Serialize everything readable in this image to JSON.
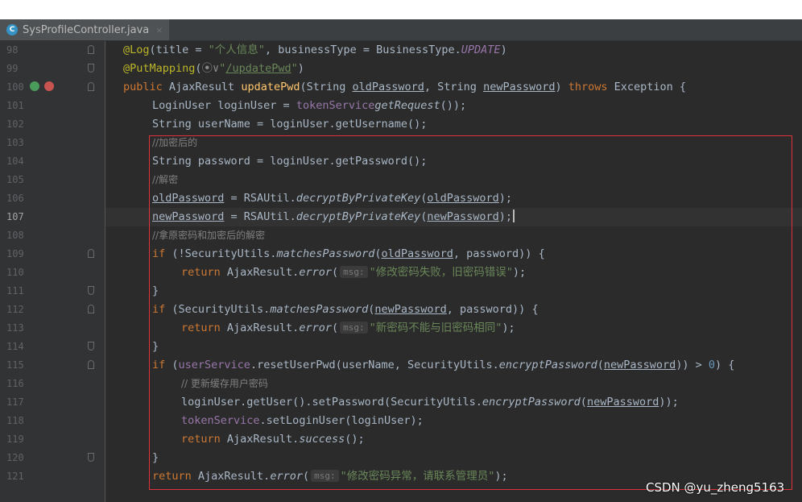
{
  "editor": {
    "tab_label": "SysProfileController.java",
    "tab_icon": "C",
    "close_glyph": "×",
    "current_line": "107"
  },
  "line_numbers": [
    "98",
    "99",
    "100",
    "101",
    "102",
    "103",
    "104",
    "105",
    "106",
    "107",
    "108",
    "109",
    "110",
    "111",
    "112",
    "113",
    "114",
    "115",
    "116",
    "117",
    "118",
    "119",
    "120",
    "121"
  ],
  "code": {
    "l98": {
      "ann": "@Log",
      "a": "(title = ",
      "s1": "\"个人信息\"",
      "b": ", businessType = BusinessType.",
      "c": "UPDATE",
      ")": ")"
    },
    "l99": {
      "ann": "@PutMapping",
      "a": "(",
      "icon": "⦿∨",
      "s1": "\"",
      "s2": "/updatePwd",
      "s3": "\"",
      ")": ")"
    },
    "l100": {
      "kw1": "public ",
      "a": "AjaxResult ",
      "fn": "updatePwd",
      "b": "(String ",
      "p1": "oldPassword",
      "c": ", String ",
      "p2": "newPassword",
      "d": ") ",
      "kw2": "throws ",
      "e": "Exception {"
    },
    "l101": {
      "a": "LoginUser loginUser = ",
      "f": "tokenService",
      ".": ".getLoginUser(ServletUtils.",
      "st": "getRequest",
      "b": "());"
    },
    "l102": {
      "a": "String userName = loginUser.getUsername();"
    },
    "l103": {
      "cm": "//加密后的"
    },
    "l104": {
      "a": "String password = loginUser.getPassword();"
    },
    "l105": {
      "cm": "//解密"
    },
    "l106": {
      "p": "oldPassword",
      "a": " = RSAUtil.",
      "st": "decryptByPrivateKey",
      "b": "(",
      "p2": "oldPassword",
      "c": ");"
    },
    "l107": {
      "p": "newPassword",
      "a": " = RSAUtil.",
      "st": "decryptByPrivateKey",
      "b": "(",
      "p2": "newPassword",
      "c": ");"
    },
    "l108": {
      "cm": "//拿原密码和加密后的解密"
    },
    "l109": {
      "kw": "if ",
      "a": "(!SecurityUtils.",
      "st": "matchesPassword",
      "b": "(",
      "p": "oldPassword",
      "c": ", password)) {"
    },
    "l110": {
      "kw": "return ",
      "a": "AjaxResult.",
      "st": "error",
      "b": "(",
      "hint": "msg:",
      "s": "\"修改密码失败，旧密码错误\"",
      "c": ");"
    },
    "l111": {
      "a": "}"
    },
    "l112": {
      "kw": "if ",
      "a": "(SecurityUtils.",
      "st": "matchesPassword",
      "b": "(",
      "p": "newPassword",
      "c": ", password)) {"
    },
    "l113": {
      "kw": "return ",
      "a": "AjaxResult.",
      "st": "error",
      "b": "(",
      "hint": "msg:",
      "s": "\"新密码不能与旧密码相同\"",
      "c": ");"
    },
    "l114": {
      "a": "}"
    },
    "l115": {
      "kw": "if ",
      "a": "(",
      "f": "userService",
      "b": ".resetUserPwd(userName, SecurityUtils.",
      "st": "encryptPassword",
      "c": "(",
      "p": "newPassword",
      "d": ")) > ",
      "n": "0",
      "e": ") {"
    },
    "l116": {
      "cm": "// 更新缓存用户密码"
    },
    "l117": {
      "a": "loginUser.getUser().setPassword(SecurityUtils.",
      "st": "encryptPassword",
      "b": "(",
      "p": "newPassword",
      "c": "));"
    },
    "l118": {
      "f": "tokenService",
      "a": ".setLoginUser(loginUser);"
    },
    "l119": {
      "kw": "return ",
      "a": "AjaxResult.",
      "st": "success",
      "b": "();"
    },
    "l120": {
      "a": "}"
    },
    "l121": {
      "kw": "return ",
      "a": "AjaxResult.",
      "st": "error",
      "b": "(",
      "hint": "msg:",
      "s": "\"修改密码异常，请联系管理员\"",
      "c": ");"
    }
  },
  "watermark": "CSDN @yu_zheng5163",
  "colors": {
    "highlight_box": "#e0323c",
    "keyword": "#cc7832",
    "string": "#6a8759",
    "annotation": "#bbb529",
    "method": "#ffc66d",
    "field": "#9876aa"
  }
}
